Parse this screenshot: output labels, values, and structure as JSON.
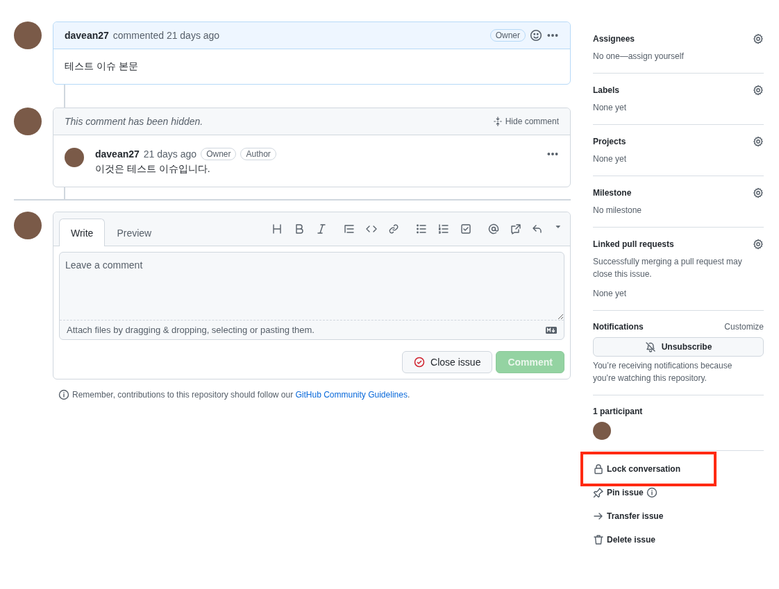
{
  "comment": {
    "author": "davean27",
    "action": "commented",
    "time": "21 days ago",
    "badges": [
      "Owner"
    ],
    "body": "테스트 이슈 본문"
  },
  "hidden_comment": {
    "notice": "This comment has been hidden.",
    "toggle": "Hide comment",
    "author": "davean27",
    "time": "21 days ago",
    "badges": [
      "Owner",
      "Author"
    ],
    "body": "이것은 테스트 이슈입니다."
  },
  "composer": {
    "tabs": [
      {
        "label": "Write",
        "selected": true
      },
      {
        "label": "Preview",
        "selected": false
      }
    ],
    "placeholder": "Leave a comment",
    "attach": "Attach files by dragging & dropping, selecting or pasting them.",
    "close_button": "Close issue",
    "comment_button": {
      "label": "Comment",
      "disabled": true
    }
  },
  "guidelines": {
    "text": "Remember, contributions to this repository should follow our ",
    "link": "GitHub Community Guidelines",
    "end": "."
  },
  "sidebar": {
    "sections": [
      {
        "title": "Assignees",
        "lines": [
          "No one—assign yourself"
        ]
      },
      {
        "title": "Labels",
        "lines": [
          "None yet"
        ]
      },
      {
        "title": "Projects",
        "lines": [
          "None yet"
        ]
      },
      {
        "title": "Milestone",
        "lines": [
          "No milestone"
        ]
      },
      {
        "title": "Linked pull requests",
        "lines": [
          "Successfully merging a pull request may close this issue.",
          "None yet"
        ]
      }
    ],
    "notifications": {
      "title": "Notifications",
      "action": "Customize",
      "button": "Unsubscribe",
      "note": "You’re receiving notifications because you’re watching this repository."
    },
    "participants": {
      "title": "1 participant"
    },
    "actions": [
      {
        "kind": "lock",
        "label": "Lock conversation",
        "highlighted": true,
        "info": false
      },
      {
        "kind": "pin",
        "label": "Pin issue",
        "highlighted": false,
        "info": true
      },
      {
        "kind": "transfer",
        "label": "Transfer issue",
        "highlighted": false,
        "info": false
      },
      {
        "kind": "delete",
        "label": "Delete issue",
        "highlighted": false,
        "info": false
      }
    ]
  }
}
